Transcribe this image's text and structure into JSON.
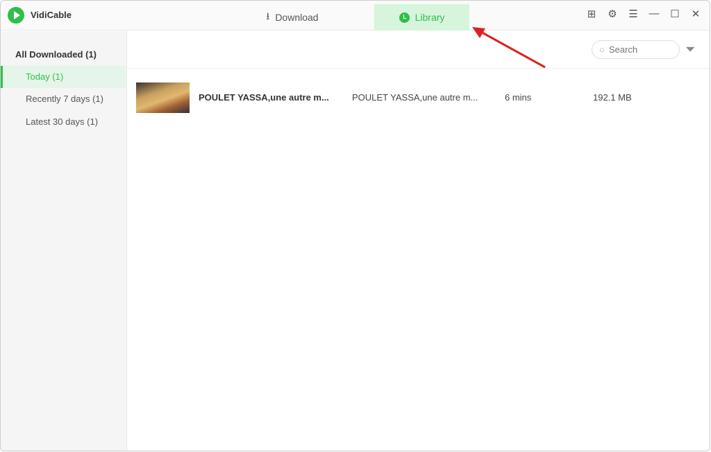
{
  "app": {
    "name": "VidiCable"
  },
  "tabs": [
    {
      "label": "Download",
      "icon": "download-icon"
    },
    {
      "label": "Library",
      "icon": "clock-icon",
      "active": true
    }
  ],
  "window_controls": [
    "grid-icon",
    "gear-icon",
    "menu-icon",
    "minimize-icon",
    "maximize-icon",
    "close-icon"
  ],
  "sidebar": {
    "header": "All Downloaded (1)",
    "items": [
      {
        "label": "Today (1)",
        "active": true
      },
      {
        "label": "Recently 7 days (1)"
      },
      {
        "label": "Latest 30 days (1)"
      }
    ]
  },
  "search": {
    "placeholder": "Search"
  },
  "rows": [
    {
      "title": "POULET YASSA,une autre m...",
      "channel": "POULET YASSA,une autre m...",
      "duration": "6 mins",
      "size": "192.1 MB"
    }
  ],
  "colors": {
    "accent": "#2fbf4a"
  }
}
